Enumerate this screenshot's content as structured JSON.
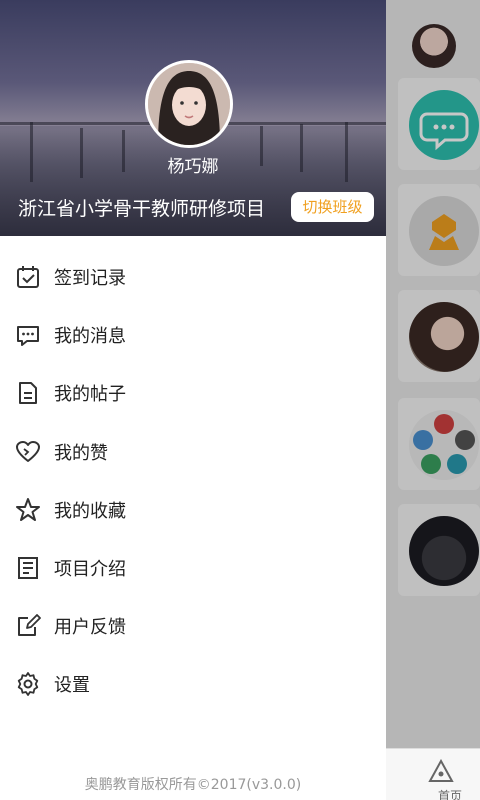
{
  "drawer": {
    "user_name": "杨巧娜",
    "project_name": "浙江省小学骨干教师研修项目",
    "switch_button": "切换班级",
    "accent_color": "#f0a020",
    "menu_items": [
      {
        "label": "签到记录",
        "icon": "calendar-check-icon"
      },
      {
        "label": "我的消息",
        "icon": "chat-bubble-icon"
      },
      {
        "label": "我的帖子",
        "icon": "document-icon"
      },
      {
        "label": "我的赞",
        "icon": "heart-icon"
      },
      {
        "label": "我的收藏",
        "icon": "star-icon"
      },
      {
        "label": "项目介绍",
        "icon": "info-list-icon"
      },
      {
        "label": "用户反馈",
        "icon": "edit-icon"
      },
      {
        "label": "设置",
        "icon": "gear-icon"
      }
    ],
    "footer": "奥鹏教育版权所有©2017(v3.0.0)"
  },
  "background_page": {
    "bottom_tab_label": "首页",
    "bottom_tab_icon": "home-triangle-icon"
  }
}
